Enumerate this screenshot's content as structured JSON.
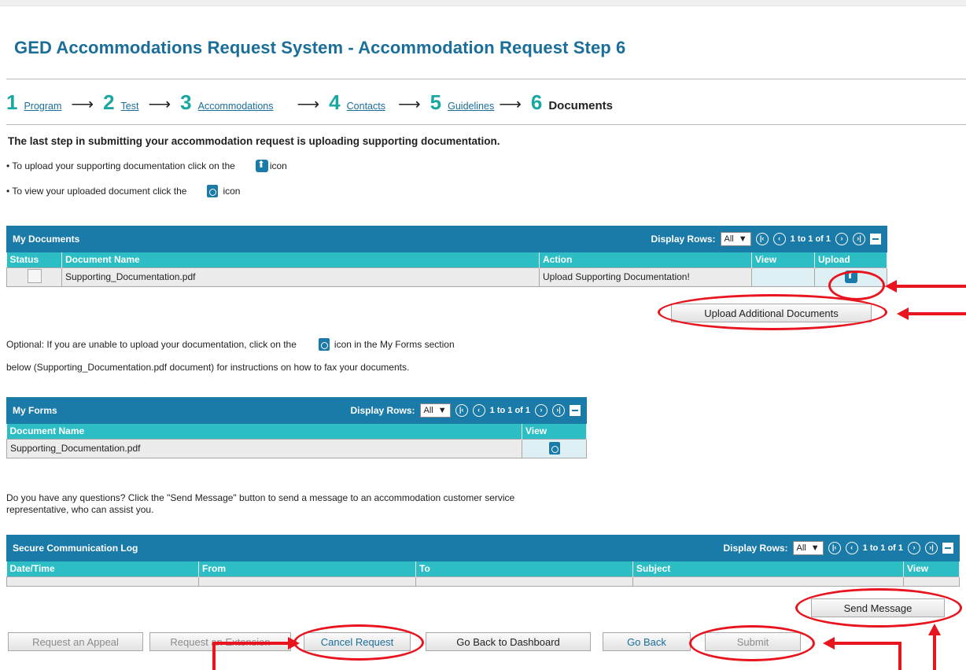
{
  "page": {
    "title": "GED Accommodations Request System - Accommodation Request Step 6"
  },
  "steps": [
    {
      "num": "1",
      "label": "Program"
    },
    {
      "num": "2",
      "label": "Test"
    },
    {
      "num": "3",
      "label": "Accommodations"
    },
    {
      "num": "4",
      "label": "Contacts"
    },
    {
      "num": "5",
      "label": "Guidelines"
    },
    {
      "num": "6",
      "label": "Documents"
    }
  ],
  "instructions": {
    "lead": "The last step in submitting your accommodation request is uploading supporting documentation.",
    "upload_pre": "• To upload your supporting documentation click on the",
    "upload_post": "icon",
    "view_pre": "• To view your uploaded document click the",
    "view_post": "icon"
  },
  "my_documents": {
    "title": "My Documents",
    "display_rows_label": "Display Rows:",
    "display_rows_value": "All",
    "page_info": "1 to 1 of 1",
    "columns": [
      "Status",
      "Document Name",
      "Action",
      "View",
      "Upload"
    ],
    "rows": [
      {
        "document_name": "Supporting_Documentation.pdf",
        "action": "Upload Supporting Documentation!"
      }
    ],
    "upload_additional_label": "Upload Additional Documents"
  },
  "optional_text": {
    "line1_pre": "Optional: If you are unable to upload your documentation, click on the",
    "line1_post": "icon in the My Forms section",
    "line2": "below (Supporting_Documentation.pdf document) for instructions on how to fax your documents."
  },
  "my_forms": {
    "title": "My Forms",
    "display_rows_label": "Display Rows:",
    "display_rows_value": "All",
    "page_info": "1 to 1 of 1",
    "columns": [
      "Document Name",
      "View"
    ],
    "rows": [
      {
        "document_name": "Supporting_Documentation.pdf"
      }
    ]
  },
  "questions_text": {
    "line1": "Do you have any questions? Click the \"Send Message\" button to send a message to an accommodation customer service",
    "line2": "representative, who can assist you."
  },
  "comm_log": {
    "title": "Secure Communication Log",
    "display_rows_label": "Display Rows:",
    "display_rows_value": "All",
    "page_info": "1 to 1 of 1",
    "columns": [
      "Date/Time",
      "From",
      "To",
      "Subject",
      "View"
    ],
    "send_message_label": "Send Message"
  },
  "actions": {
    "request_appeal": "Request an Appeal",
    "request_extension": "Request an Extension",
    "cancel_request": "Cancel Request",
    "go_back_dashboard": "Go Back to Dashboard",
    "go_back": "Go Back",
    "submit": "Submit"
  },
  "colors": {
    "header_bar": "#1a7aa8",
    "column_header": "#2cbec4",
    "title_text": "#1a6e9a",
    "step_number": "#1aa7a1",
    "annotation_red": "#e8141e"
  }
}
